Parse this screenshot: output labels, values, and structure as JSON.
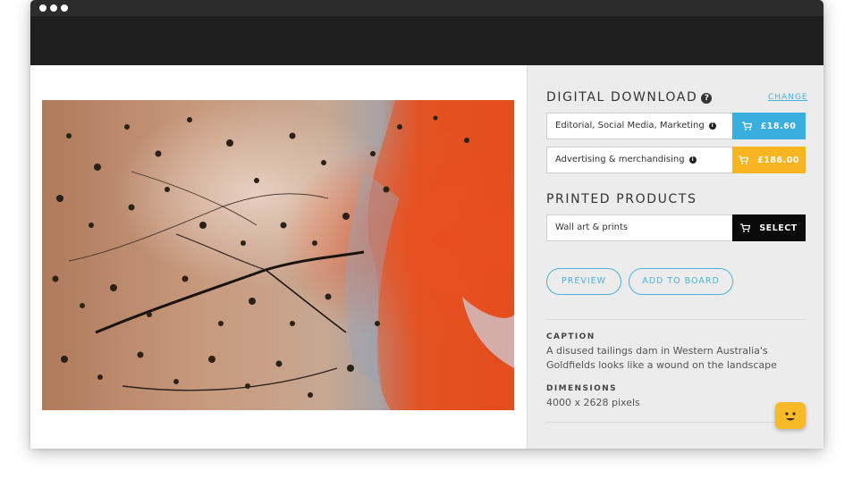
{
  "digital_download": {
    "title": "DIGITAL DOWNLOAD",
    "change_label": "CHANGE",
    "options": [
      {
        "label": "Editorial, Social Media, Marketing",
        "price": "£18.60",
        "color": "#3aaede"
      },
      {
        "label": "Advertising & merchandising",
        "price": "£186.00",
        "color": "#f7b522"
      }
    ]
  },
  "printed_products": {
    "title": "PRINTED PRODUCTS",
    "option_label": "Wall art & prints",
    "select_label": "SELECT"
  },
  "actions": {
    "preview_label": "PREVIEW",
    "add_to_board_label": "ADD TO BOARD"
  },
  "caption": {
    "label": "CAPTION",
    "text": "A disused tailings dam in Western Australia's Goldfields looks like a wound on the landscape"
  },
  "dimensions": {
    "label": "DIMENSIONS",
    "text": "4000 x 2628 pixels"
  },
  "colors": {
    "accent": "#4ab3dc",
    "chrome_dark": "#1e1e1e",
    "panel_bg": "#ececec"
  }
}
